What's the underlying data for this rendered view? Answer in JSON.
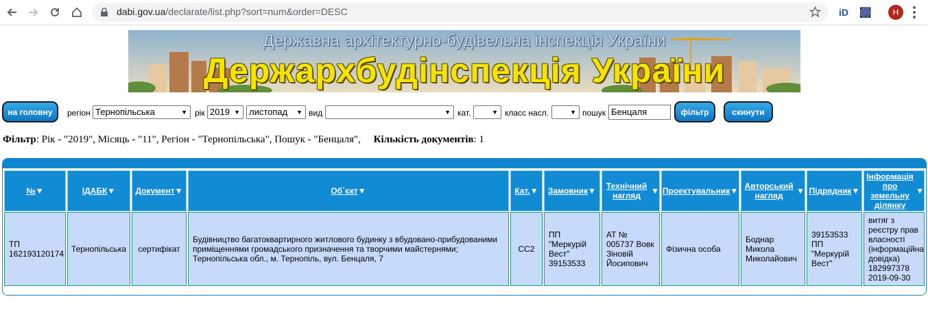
{
  "browser": {
    "url_domain": "dabi.gov.ua",
    "url_path": "/declarate/list.php?sort=num&order=DESC",
    "avatar_letter": "Н",
    "extensions": [
      "iD",
      "🎆"
    ]
  },
  "banner": {
    "subtitle": "Державна архітектурно-будівельна інспекція України",
    "title": "Держархбудінспекція України"
  },
  "filters": {
    "home_button": "на головну",
    "region_label": "регіон",
    "region_value": "Тернопільська",
    "year_label": "рік",
    "year_value": "2019",
    "month_value": "листопад",
    "type_label": "вид",
    "type_value": "",
    "cat_label": "кат.",
    "cat_value": "",
    "class_label": "класс насл.",
    "class_value": "",
    "search_label": "пошук",
    "search_value": "Бенцаля",
    "filter_button": "фільтр",
    "reset_button": "скинути"
  },
  "summary": {
    "filter_label": "Фільтр",
    "filter_text": ": Рік - \"2019\", Місяць - \"11\", Регіон - \"Тернопільська\", Пошук - \"Бенцаля\",",
    "count_label": "Кількість документів",
    "count_value": ": 1"
  },
  "table": {
    "headers": [
      "№",
      "ІДАБК",
      "Документ",
      "Об`єкт",
      "Кат.",
      "Замовник",
      "Технічний нагляд",
      "Проектувальник",
      "Авторський нагляд",
      "Підрядник",
      "Інформація про земельну ділянку"
    ],
    "row": [
      "ТП 162193120174",
      "Тернопільська",
      "сертифікат",
      "Будівництво багатоквартирного житлового будинку з вбудовано-прибудованими приміщеннями громадського призначення та творчими майстернями; Тернопільська обл., м. Тернопіль, вул. Бенцаля, 7",
      "СС2",
      "ПП \"Меркурій Вест\" 39153533",
      "АТ № 005737 Вовк Зіновій Йосипович",
      "Фізична особа",
      "Боднар Микола Миколайович",
      "39153533 ПП \"Меркурій Вест\"",
      "витяг з реєстру прав власності (інформаційна довідка) 182997378 2019-09-30"
    ]
  },
  "colors": {
    "header_blue": "#118bd3",
    "cell_bg": "#c7dafa",
    "button_blue": "#0c77c4",
    "banner_yellow": "#f6e300"
  }
}
